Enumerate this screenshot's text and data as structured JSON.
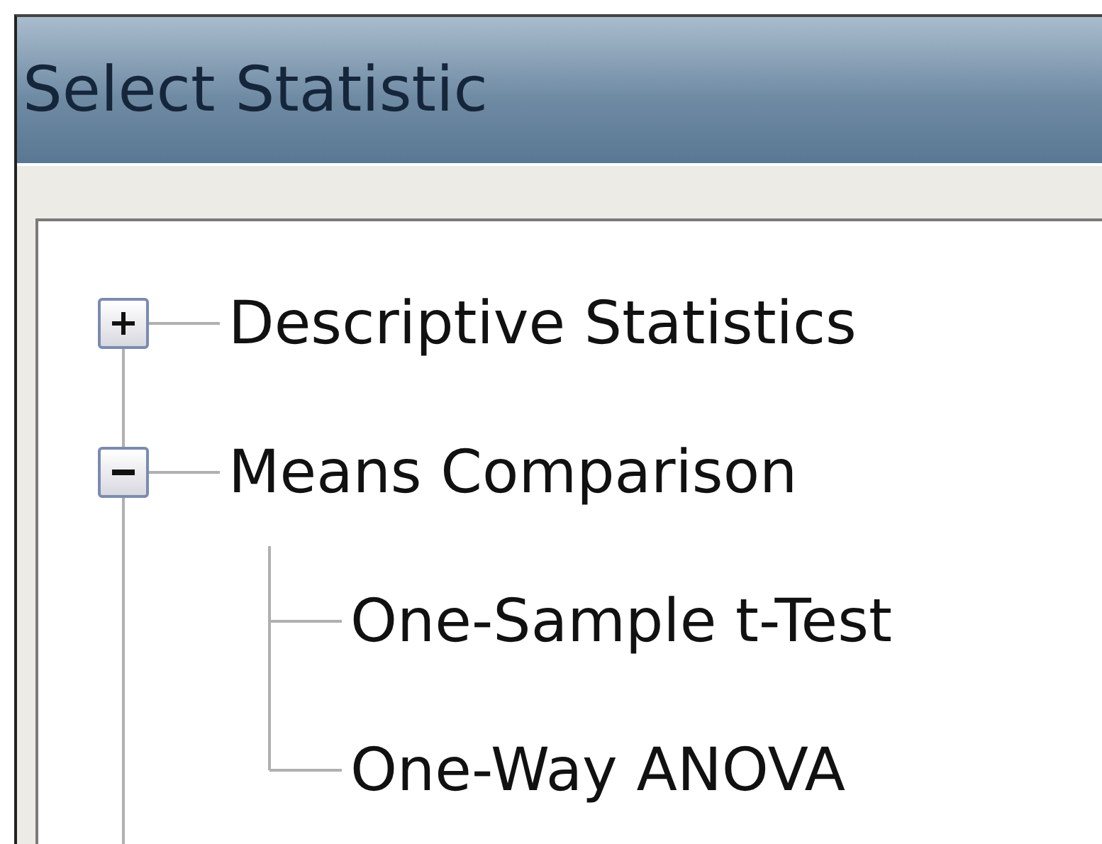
{
  "window": {
    "title": "Select Statistic"
  },
  "tree": [
    {
      "label": "Descriptive Statistics",
      "expanded": false
    },
    {
      "label": "Means Comparison",
      "expanded": true,
      "children": [
        {
          "label": "One-Sample t-Test"
        },
        {
          "label": "One-Way ANOVA"
        }
      ]
    }
  ]
}
